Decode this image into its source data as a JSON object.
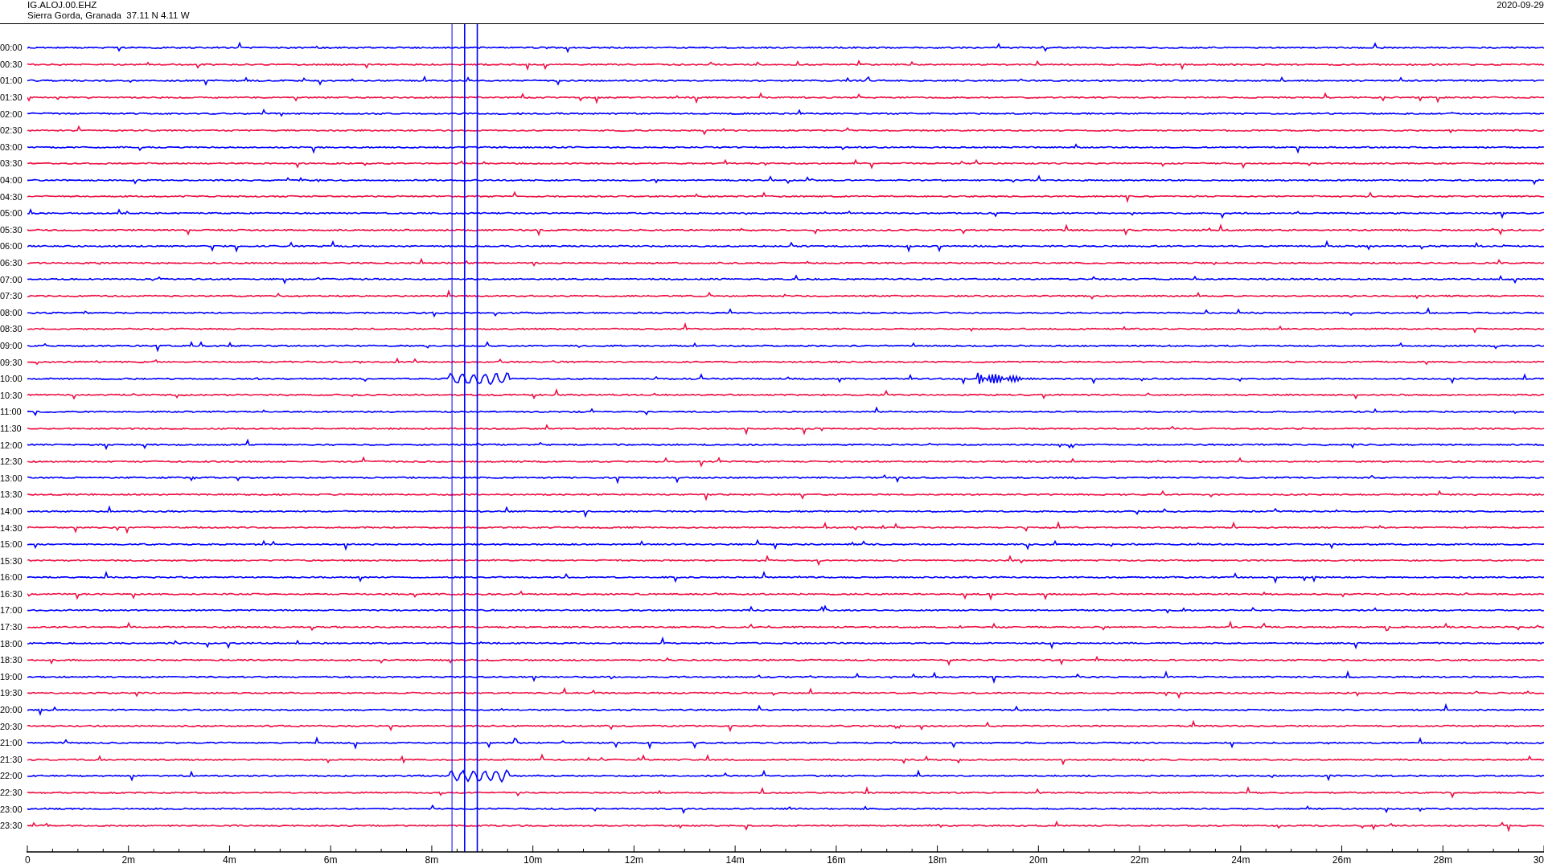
{
  "header": {
    "station": "IG.ALOJ.00.EHZ",
    "location": "Sierra Gorda, Granada  37.11 N 4.11 W",
    "date": "2020-09-29"
  },
  "rows": [
    {
      "label": "00:00",
      "color": "#0000ff"
    },
    {
      "label": "00:30",
      "color": "#ee1144"
    },
    {
      "label": "01:00",
      "color": "#0000ff"
    },
    {
      "label": "01:30",
      "color": "#ee1144"
    },
    {
      "label": "02:00",
      "color": "#0000ff"
    },
    {
      "label": "02:30",
      "color": "#ee1144"
    },
    {
      "label": "03:00",
      "color": "#0000ff"
    },
    {
      "label": "03:30",
      "color": "#ee1144"
    },
    {
      "label": "04:00",
      "color": "#0000ff"
    },
    {
      "label": "04:30",
      "color": "#ee1144"
    },
    {
      "label": "05:00",
      "color": "#0000ff"
    },
    {
      "label": "05:30",
      "color": "#ee1144"
    },
    {
      "label": "06:00",
      "color": "#0000ff"
    },
    {
      "label": "06:30",
      "color": "#ee1144"
    },
    {
      "label": "07:00",
      "color": "#0000ff"
    },
    {
      "label": "07:30",
      "color": "#ee1144"
    },
    {
      "label": "08:00",
      "color": "#0000ff"
    },
    {
      "label": "08:30",
      "color": "#ee1144"
    },
    {
      "label": "09:00",
      "color": "#0000ff"
    },
    {
      "label": "09:30",
      "color": "#ee1144"
    },
    {
      "label": "10:00",
      "color": "#0000ff"
    },
    {
      "label": "10:30",
      "color": "#ee1144"
    },
    {
      "label": "11:00",
      "color": "#0000ff"
    },
    {
      "label": "11:30",
      "color": "#ee1144"
    },
    {
      "label": "12:00",
      "color": "#0000ff"
    },
    {
      "label": "12:30",
      "color": "#ee1144"
    },
    {
      "label": "13:00",
      "color": "#0000ff"
    },
    {
      "label": "13:30",
      "color": "#ee1144"
    },
    {
      "label": "14:00",
      "color": "#0000ff"
    },
    {
      "label": "14:30",
      "color": "#ee1144"
    },
    {
      "label": "15:00",
      "color": "#0000ff"
    },
    {
      "label": "15:30",
      "color": "#ee1144"
    },
    {
      "label": "16:00",
      "color": "#0000ff"
    },
    {
      "label": "16:30",
      "color": "#ee1144"
    },
    {
      "label": "17:00",
      "color": "#0000ff"
    },
    {
      "label": "17:30",
      "color": "#ee1144"
    },
    {
      "label": "18:00",
      "color": "#0000ff"
    },
    {
      "label": "18:30",
      "color": "#ee1144"
    },
    {
      "label": "19:00",
      "color": "#0000ff"
    },
    {
      "label": "19:30",
      "color": "#ee1144"
    },
    {
      "label": "20:00",
      "color": "#0000ff"
    },
    {
      "label": "20:30",
      "color": "#ee1144"
    },
    {
      "label": "21:00",
      "color": "#0000ff"
    },
    {
      "label": "21:30",
      "color": "#ee1144"
    },
    {
      "label": "22:00",
      "color": "#0000ff"
    },
    {
      "label": "22:30",
      "color": "#ee1144"
    },
    {
      "label": "23:00",
      "color": "#0000ff"
    },
    {
      "label": "23:30",
      "color": "#ee1144"
    }
  ],
  "x_axis": {
    "ticks": [
      "0",
      "2m",
      "4m",
      "6m",
      "8m",
      "10m",
      "12m",
      "14m",
      "16m",
      "18m",
      "20m",
      "22m",
      "24m",
      "26m",
      "28m",
      "30"
    ]
  }
}
